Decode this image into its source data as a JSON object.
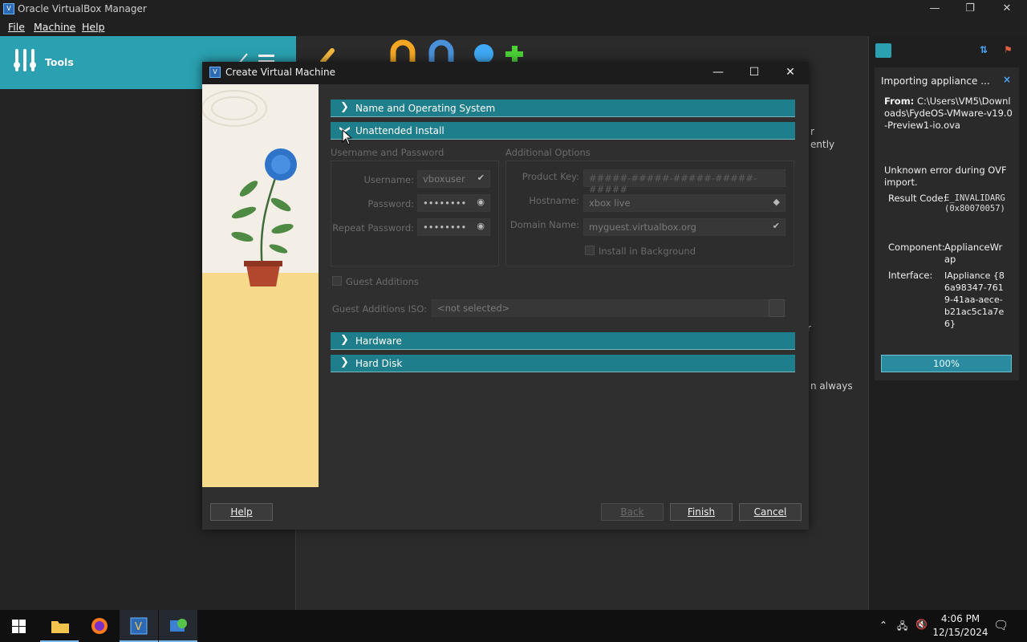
{
  "window": {
    "title": "Oracle VirtualBox Manager",
    "minimize": "—",
    "maximize": "❐",
    "close": "✕"
  },
  "menu": {
    "file": "File",
    "machine": "Machine",
    "help": "Help"
  },
  "tools": {
    "label": "Tools"
  },
  "background_fragments": [
    "r",
    "ently",
    "r",
    "n always"
  ],
  "notification": {
    "title": "Importing appliance ...",
    "close": "×",
    "from_label": "From:",
    "from_path": "C:\\Users\\VM5\\Downloads\\FydeOS-VMware-v19.0-Preview1-io.ova",
    "error": "Unknown error during OVF import.",
    "rows": [
      {
        "label": "Result Code:",
        "value": "E_INVALIDARG (0x80070057)"
      },
      {
        "label": "Component:",
        "value": "ApplianceWrap"
      },
      {
        "label": "Interface:",
        "value": "IAppliance {86a98347-7619-41aa-aece-b21ac5c1a7e6}"
      }
    ],
    "progress_text": "100%",
    "progress_value": 100
  },
  "dialog": {
    "title": "Create Virtual Machine",
    "minimize": "—",
    "maximize": "☐",
    "close": "✕",
    "sections": {
      "name_os": "Name and Operating System",
      "unattended": "Unattended Install",
      "hardware": "Hardware",
      "hard_disk": "Hard Disk"
    },
    "username_password_group": "Username and Password",
    "additional_options_group": "Additional Options",
    "username_label": "Username:",
    "username_value": "vboxuser",
    "password_label": "Password:",
    "password_value": "••••••••",
    "repeat_password_label": "Repeat Password:",
    "repeat_password_value": "••••••••",
    "product_key_label": "Product Key:",
    "product_key_placeholder": "#####-#####-#####-#####-#####",
    "hostname_label": "Hostname:",
    "hostname_value": "xbox live",
    "domain_label": "Domain Name:",
    "domain_value": "myguest.virtualbox.org",
    "install_background": "Install in Background",
    "guest_additions": "Guest Additions",
    "guest_additions_iso_label": "Guest Additions ISO:",
    "guest_additions_iso_value": "<not selected>",
    "buttons": {
      "help": "Help",
      "back": "Back",
      "finish": "Finish",
      "cancel": "Cancel"
    }
  },
  "taskbar": {
    "time": "4:06 PM",
    "date": "12/15/2024"
  },
  "colors": {
    "accent": "#1f7e8c",
    "tools_bg": "#2aa0b0",
    "progress": "#2a8aa0"
  }
}
